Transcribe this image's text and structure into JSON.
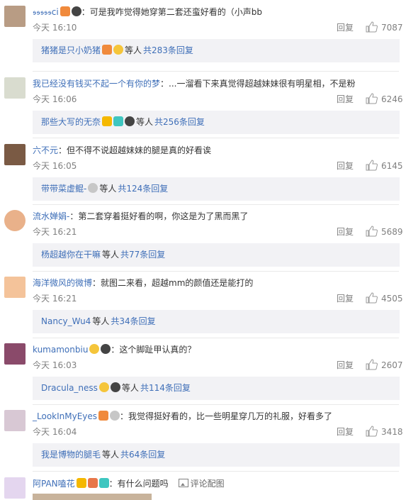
{
  "ui": {
    "like_icon": "thumb-up-icon",
    "reply_label": "回复",
    "etc_label": "等人"
  },
  "comments": [
    {
      "user": "𝖘𝖘𝖘𝖘𝖘ci",
      "text": "：可是我咋觉得她穿第二套还蛮好看的（小声bb",
      "time": "今天 16:10",
      "likes": "7087",
      "reply_user": "猪猪是只小奶猪",
      "reply_total": "共283条回复"
    },
    {
      "user": "我已经没有钱买不起一个有你的梦",
      "text": "：...一溜看下来真觉得超越妹妹很有明星相，不是粉",
      "time": "今天 16:06",
      "likes": "6246",
      "reply_user": "那些大写的无奈",
      "reply_total": "共256条回复"
    },
    {
      "user": "六不元",
      "text": "：但不得不说超越妹妹的腿是真的好看诶",
      "time": "今天 16:05",
      "likes": "6145",
      "reply_user": "带带菜虚鲲-",
      "reply_total": "共124条回复"
    },
    {
      "user": "流水婵娟-",
      "text": "：第二套穿着挺好看的啊，你这是为了黑而黑了",
      "time": "今天 16:21",
      "likes": "5689",
      "reply_user": "杨超越你在干嘛",
      "reply_total": "共77条回复"
    },
    {
      "user": "海洋微风的微博",
      "text": "：就图二来看，超越mm的颜值还是能打的",
      "time": "今天 16:21",
      "likes": "4505",
      "reply_user": "Nancy_Wu4",
      "reply_total": "共34条回复"
    },
    {
      "user": "kumamonbiu",
      "text": "：这个脚趾甲认真的？",
      "time": "今天 16:03",
      "likes": "2607",
      "reply_user": "Dracula_ness",
      "reply_total": "共114条回复"
    },
    {
      "user": "_LookInMyEyes",
      "text": "：我觉得挺好看的，比一些明星穿几万的礼服，好看多了",
      "time": "今天 16:04",
      "likes": "3418",
      "reply_user": "我是博物的腿毛",
      "reply_total": "共64条回复"
    }
  ],
  "last_comment": {
    "user": "阿PAN嗑花",
    "text": "：有什么问题吗",
    "pic_label": "评论配图"
  }
}
